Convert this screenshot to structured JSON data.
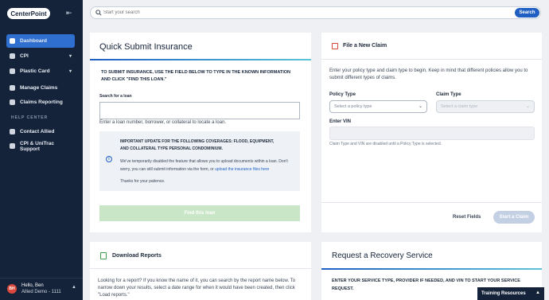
{
  "brand": {
    "logo_text": "CenterPoint"
  },
  "sidebar": {
    "items": [
      {
        "label": "Dashboard",
        "active": true
      },
      {
        "label": "CPI",
        "expandable": true
      },
      {
        "label": "Plastic Card",
        "expandable": true
      },
      {
        "label": "Manage Claims"
      },
      {
        "label": "Claims Reporting"
      }
    ],
    "help_header": "HELP CENTER",
    "help_items": [
      {
        "label": "Contact Allied"
      },
      {
        "label": "CPI & UniTrac Support"
      }
    ],
    "user": {
      "initials": "BH",
      "greeting": "Hello, Ben",
      "org": "Allied Demo - 1111"
    }
  },
  "search": {
    "placeholder": "Start your search",
    "button_label": "Search"
  },
  "quick_submit": {
    "title": "Quick Submit Insurance",
    "instructions": "TO SUBMIT INSURANCE, USE THE FIELD BELOW TO TYPE IN THE KNOWN INFORMATION AND CLICK \"FIND THIS LOAN.\"",
    "search_label": "Search for a loan",
    "search_value": "",
    "helper_text": "Enter a loan number, borrower, or collateral to locate a loan.",
    "notice": {
      "heading": "IMPORTANT UPDATE FOR THE FOLLOWING COVERAGES: FLOOD, EQUIPMENT, AND COLLATERAL TYPE PERSONAL CONDOMINIUM.",
      "body": "We've temporarily disabled the feature that allows you to upload documents within a loan. Don't worry, you can still submit information via the form, or",
      "link": "upload the insurance files here",
      "thanks": "Thanks for your patience."
    },
    "button_label": "Find this loan"
  },
  "file_claim": {
    "title": "File a New Claim",
    "description": "Enter your policy type and claim type to begin. Keep in mind that different policies allow you to submit different types of claims.",
    "policy_type_label": "Policy Type",
    "policy_type_placeholder": "Select a policy type",
    "claim_type_label": "Claim Type",
    "claim_type_placeholder": "Select a claim type",
    "vin_label": "Enter VIN",
    "note": "Claim Type and VIN are disabled until a Policy Type is selected.",
    "reset_label": "Reset Fields",
    "start_label": "Start a Claim"
  },
  "download_reports": {
    "title": "Download Reports",
    "description": "Looking for a report? If you know the name of it, you can search by the report name below. To narrow down your results, select a date range for when it would have been created, then click \"Load reports.\""
  },
  "recovery": {
    "title": "Request a Recovery Service",
    "description": "ENTER YOUR SERVICE TYPE, PROVIDER IF NEEDED, AND VIN TO START YOUR SERVICE REQUEST."
  },
  "training": {
    "label": "Training Resources"
  },
  "colors": {
    "sidebar_bg": "#14233a",
    "accent": "#2f6fd0",
    "primary_button": "#1f5fc4",
    "success_disabled": "#c9e6c7"
  }
}
